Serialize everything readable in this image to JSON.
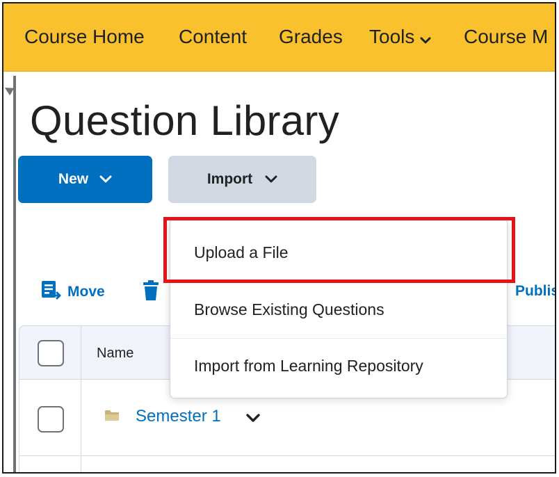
{
  "nav": {
    "items": [
      "Course Home",
      "Content",
      "Grades",
      "Tools",
      "Course M"
    ],
    "accent_color": "#f9c12e"
  },
  "page": {
    "title": "Question Library"
  },
  "buttons": {
    "new_label": "New",
    "import_label": "Import"
  },
  "toolbar": {
    "move_label": "Move",
    "publish_label": "Publis"
  },
  "table": {
    "header_name": "Name",
    "rows": [
      {
        "name": "Semester 1",
        "icon": "folder-icon"
      }
    ]
  },
  "dropdown": {
    "items": [
      "Upload a File",
      "Browse Existing Questions",
      "Import from Learning Repository"
    ],
    "highlighted_index": 0,
    "highlight_color": "#e5131a"
  },
  "colors": {
    "link": "#006fbf",
    "primary_button": "#006fbf",
    "secondary_button": "#d3d9e3"
  }
}
